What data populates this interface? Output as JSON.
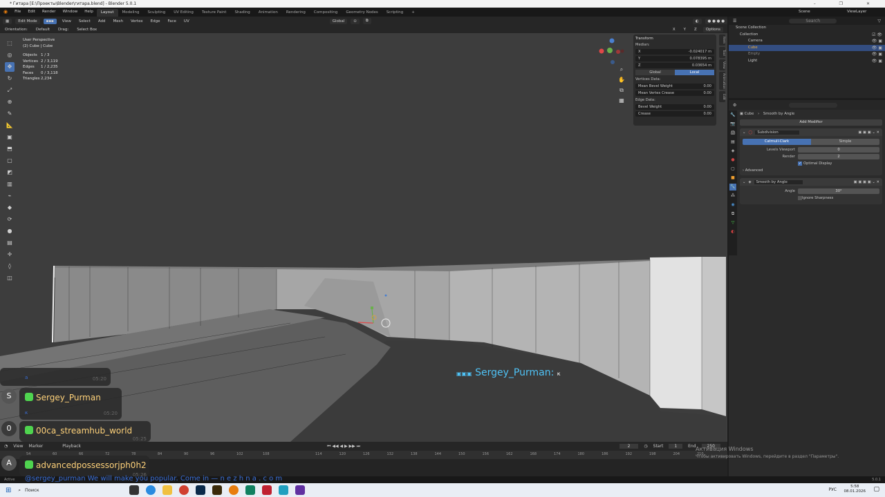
{
  "window": {
    "title": "* Гитара [E:\\Проекты\\Blender\\гитара.blend] - Blender 5.0.1",
    "controls": "–  ❐  ✕"
  },
  "menu": [
    "File",
    "Edit",
    "Render",
    "Window",
    "Help"
  ],
  "workspaces": [
    "Layout",
    "Modeling",
    "Sculpting",
    "UV Editing",
    "Texture Paint",
    "Shading",
    "Animation",
    "Rendering",
    "Compositing",
    "Geometry Nodes",
    "Scripting",
    "+"
  ],
  "scene": {
    "scene_label": "Scene",
    "view_layer_label": "ViewLayer"
  },
  "viewport_header": {
    "mode": "Edit Mode",
    "menus": [
      "View",
      "Select",
      "Add",
      "Mesh",
      "Vertex",
      "Edge",
      "Face",
      "UV"
    ],
    "transform_orientation": "Global",
    "orientation_label": "Orientation:",
    "orientation_value": "Default",
    "drag_label": "Drag:",
    "drag_value": "Select Box",
    "options": "Options",
    "xyz": [
      "X",
      "Y",
      "Z"
    ]
  },
  "stats": {
    "title": "User Perspective",
    "object": "(2) Cube | Cube",
    "rows": [
      {
        "k": "Objects",
        "v": "1 / 3"
      },
      {
        "k": "Vertices",
        "v": "2 / 3,119"
      },
      {
        "k": "Edges",
        "v": "1 / 2,235"
      },
      {
        "k": "Faces",
        "v": "0 / 3,118"
      },
      {
        "k": "Triangles",
        "v": "2,234"
      }
    ]
  },
  "npanel": {
    "title": "Transform",
    "median_label": "Median:",
    "x": {
      "label": "X",
      "value": "-0.024017 m"
    },
    "y": {
      "label": "Y",
      "value": "0.078395 m"
    },
    "z": {
      "label": "Z",
      "value": "0.03654 m"
    },
    "global": "Global",
    "local": "Local",
    "vertices_data": "Vertices Data:",
    "mean_bevel": {
      "label": "Mean Bevel Weight",
      "value": "0.00"
    },
    "mean_crease": {
      "label": "Mean Vertex Crease",
      "value": "0.00"
    },
    "edge_data": "Edge Data:",
    "bevel_weight": {
      "label": "Bevel Weight",
      "value": "0.00"
    },
    "crease": {
      "label": "Crease",
      "value": "0.00"
    },
    "side_tabs": [
      "Item",
      "Tool",
      "View",
      "Animation",
      "Edit"
    ]
  },
  "outliner": {
    "search_placeholder": "Search",
    "rows": [
      {
        "label": "Scene Collection",
        "sel": false
      },
      {
        "label": "Collection",
        "sel": false
      },
      {
        "label": "Camera",
        "sel": false
      },
      {
        "label": "Cube",
        "sel": true
      },
      {
        "label": "Empty",
        "sel": false
      },
      {
        "label": "Light",
        "sel": false
      }
    ]
  },
  "properties": {
    "breadcrumb_object": "Cube",
    "breadcrumb_modifier": "Smooth by Angle",
    "add_modifier": "Add Modifier",
    "subdivision": {
      "name": "Subdivision",
      "mode_on": "Catmull-Clark",
      "mode_off": "Simple",
      "levels_viewport": {
        "label": "Levels Viewport",
        "value": "0"
      },
      "render": {
        "label": "Render",
        "value": "2"
      },
      "optimal_display": "Optimal Display",
      "advanced": "Advanced"
    },
    "smooth": {
      "name": "Smooth by Angle",
      "angle": {
        "label": "Angle",
        "value": "30°"
      },
      "ignore_sharpness": "Ignore Sharpness"
    }
  },
  "timeline": {
    "menus": [
      "View",
      "Marker",
      "Playback"
    ],
    "current_frame": "2",
    "start_label": "Start",
    "start": "1",
    "end_label": "End",
    "end": "250",
    "ticks": [
      "114",
      "120",
      "126",
      "132",
      "138",
      "144",
      "150",
      "156",
      "162",
      "168",
      "174",
      "180",
      "186",
      "192",
      "198",
      "204",
      "210"
    ],
    "left_ticks": [
      "54",
      "60",
      "66",
      "72",
      "78",
      "84",
      "90",
      "96",
      "102",
      "108"
    ]
  },
  "status": {
    "left": "Active",
    "version": "5.0.1"
  },
  "overlay": {
    "floating_name": "Sergey_Purman:",
    "floating_suffix": "к",
    "chats": [
      {
        "avatar": "",
        "name": "",
        "text": "a",
        "time": "05:20"
      },
      {
        "avatar": "S",
        "name": "Sergey_Purman",
        "text": "к",
        "time": "05:20"
      },
      {
        "avatar": "0",
        "name": "00ca_streamhub_world",
        "text": "",
        "time": "05:25"
      },
      {
        "avatar": "A",
        "name": "advancedpossessorjph0h2",
        "text": "",
        "time": "05:26"
      }
    ],
    "promo": "@sergey_purman We will make you popular. Come in — n e z h n a . c o m",
    "activate_title": "Активация Windows",
    "activate_text": "Чтобы активировать Windows, перейдите в раздел \"Параметры\"."
  },
  "taskbar": {
    "search": "Поиск",
    "lang": "РУС",
    "time": "5:58",
    "date": "08.01.2026"
  },
  "colors": {
    "accent": "#4772b3",
    "chat_badge": "#4fd44f",
    "floating_name": "#4fc3f7"
  }
}
